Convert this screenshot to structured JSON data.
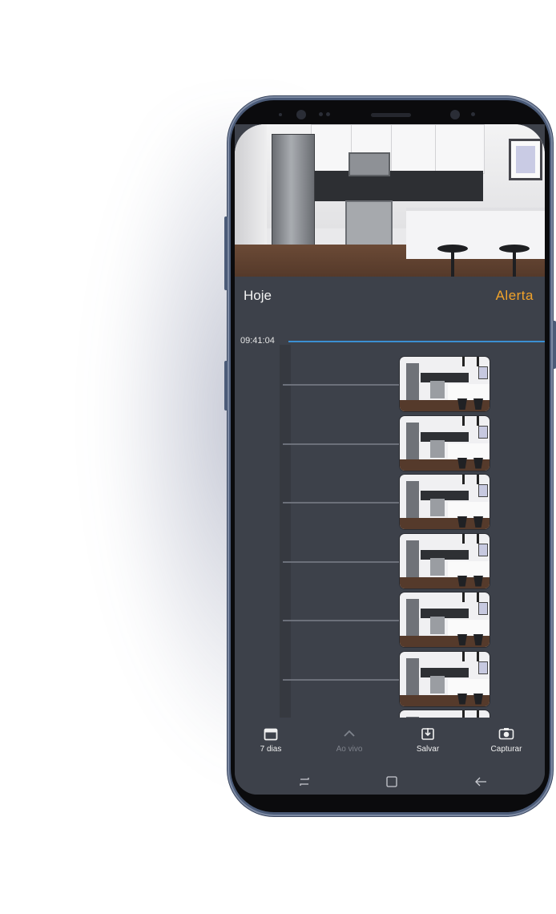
{
  "timeline": {
    "day_label": "Hoje",
    "alert_label": "Alerta",
    "current_time": "09:41:04",
    "event_count": 7
  },
  "tabbar": {
    "items": [
      {
        "label": "7 dias",
        "icon": "calendar-icon",
        "enabled": true
      },
      {
        "label": "Ao vivo",
        "icon": "chevron-up-icon",
        "enabled": false
      },
      {
        "label": "Salvar",
        "icon": "download-icon",
        "enabled": true
      },
      {
        "label": "Capturar",
        "icon": "camera-icon",
        "enabled": true
      }
    ]
  },
  "navbar": {
    "items": [
      {
        "icon": "recent-apps-icon"
      },
      {
        "icon": "home-square-icon"
      },
      {
        "icon": "back-arrow-icon"
      }
    ]
  },
  "colors": {
    "accent_alert": "#f0a22a",
    "timeline_cursor": "#3b8fd2",
    "app_background": "#3d414a",
    "phone_frame": "#4b5b78"
  }
}
